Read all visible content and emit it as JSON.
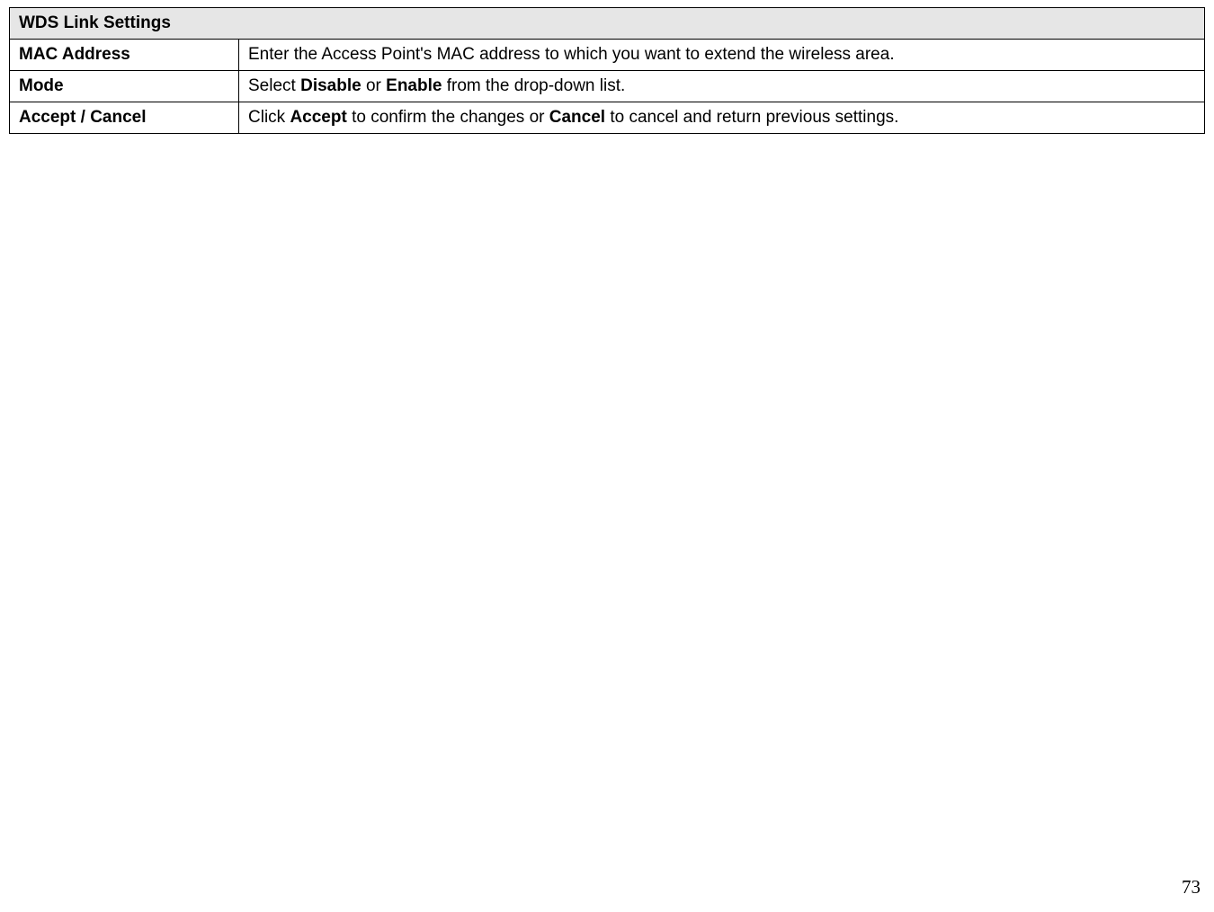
{
  "table": {
    "header": "WDS Link Settings",
    "rows": [
      {
        "label": "MAC Address",
        "segments": [
          {
            "text": "Enter the Access Point's MAC address to which you want to extend the wireless area.",
            "bold": false
          }
        ]
      },
      {
        "label": "Mode",
        "segments": [
          {
            "text": "Select ",
            "bold": false
          },
          {
            "text": "Disable",
            "bold": true
          },
          {
            "text": " or ",
            "bold": false
          },
          {
            "text": "Enable",
            "bold": true
          },
          {
            "text": " from the drop-down list.",
            "bold": false
          }
        ]
      },
      {
        "label": "Accept / Cancel",
        "segments": [
          {
            "text": "Click ",
            "bold": false
          },
          {
            "text": "Accept",
            "bold": true
          },
          {
            "text": " to confirm the changes or ",
            "bold": false
          },
          {
            "text": "Cancel",
            "bold": true
          },
          {
            "text": " to cancel and return previous settings.",
            "bold": false
          }
        ]
      }
    ]
  },
  "page_number": "73"
}
